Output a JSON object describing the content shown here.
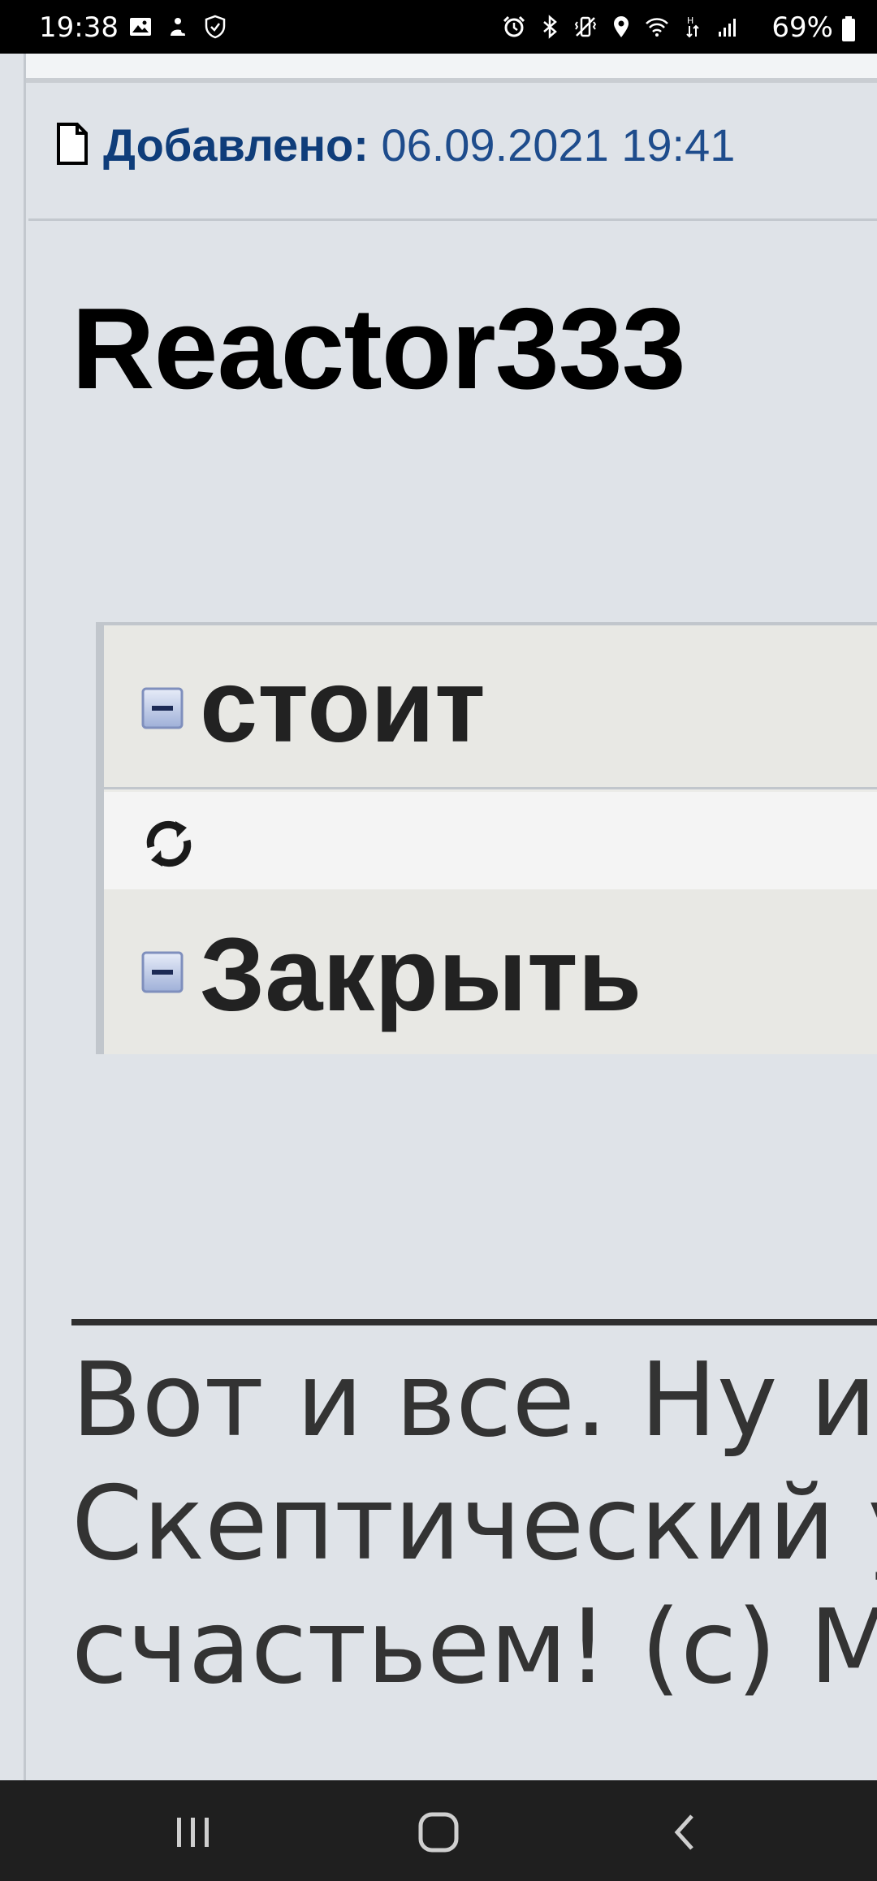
{
  "status_bar": {
    "time": "19:38",
    "battery_percent": "69%",
    "left_icons": [
      "gallery-icon",
      "notification-icon",
      "shield-icon"
    ],
    "right_icons": [
      "alarm-icon",
      "bluetooth-icon",
      "vibrate-icon",
      "location-icon",
      "wifi-icon",
      "data-arrows-icon",
      "signal-icon"
    ]
  },
  "post": {
    "added_label": "Добавлено:",
    "added_value": "06.09.2021 19:41",
    "text": "Reactor333"
  },
  "spoiler": {
    "header_label": "стоит",
    "footer_label": "Закрыть"
  },
  "signature": {
    "line1": "Вот и все. Ну и ч",
    "line2": "Скептический ум",
    "line3": "счастьем! (с) Ма"
  },
  "colors": {
    "page_bg": "#dfe3e8",
    "link_blue": "#1e4c8c",
    "spoiler_bg": "#e8e8e4"
  }
}
